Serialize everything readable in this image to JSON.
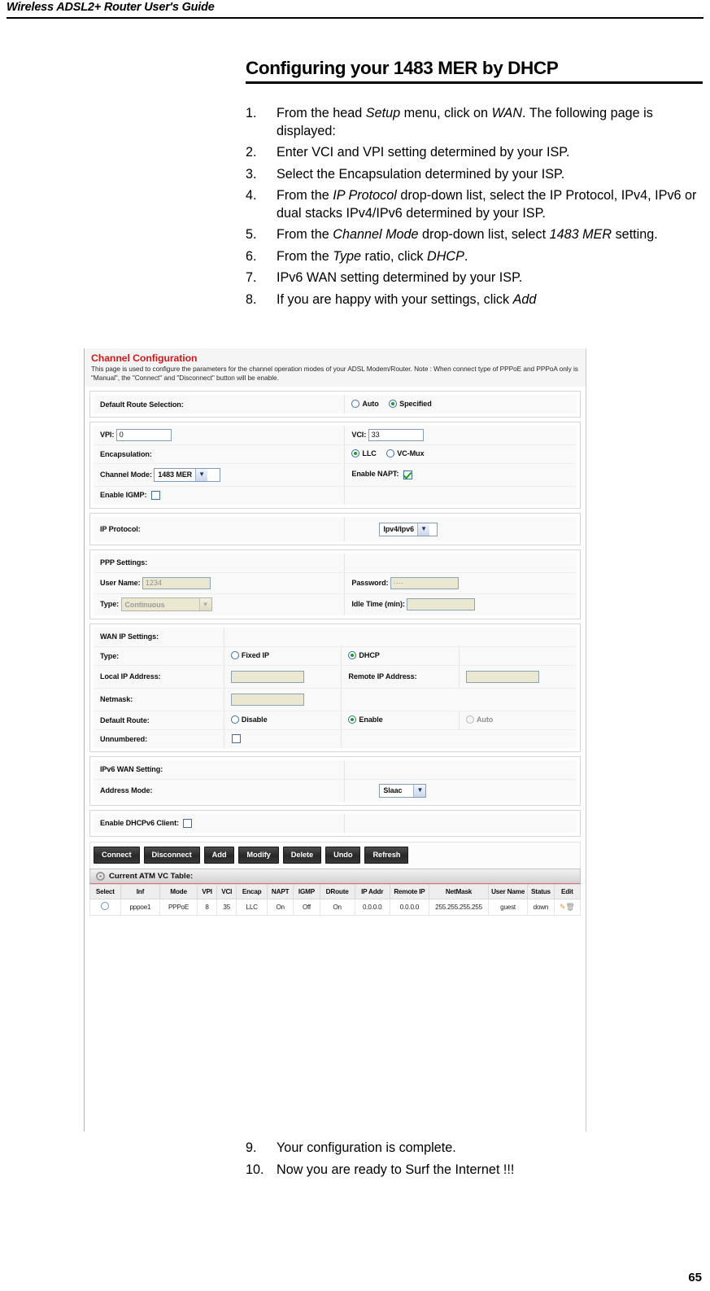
{
  "header": {
    "running_title": "Wireless ADSL2+ Router User's Guide"
  },
  "section": {
    "title": "Configuring your 1483 MER by DHCP"
  },
  "steps_top": [
    {
      "num": "1.",
      "html": "From the head <i>Setup</i> menu, click on <i>WAN</i>. The following page is displayed:"
    },
    {
      "num": "2.",
      "html": "Enter VCI and VPI setting determined by your ISP."
    },
    {
      "num": "3.",
      "html": "Select the Encapsulation determined by your ISP."
    },
    {
      "num": "4.",
      "html": "From the <i>IP Protocol</i> drop-down list, select the IP Protocol, IPv4, IPv6 or dual stacks IPv4/IPv6 determined by your ISP."
    },
    {
      "num": "5.",
      "html": "From the <i>Channel Mode</i> drop-down list, select <i>1483 MER</i> setting."
    },
    {
      "num": "6.",
      "html": "From the <i>Type</i> ratio, click <i>DHCP</i>."
    },
    {
      "num": "7.",
      "html": "IPv6 WAN setting determined by your ISP."
    },
    {
      "num": "8.",
      "html": "If you are happy with your settings, click <i>Add</i>"
    }
  ],
  "steps_bottom": [
    {
      "num": "9.",
      "html": "Your configuration is complete."
    },
    {
      "num": "10.",
      "html": "Now you are ready to Surf the Internet !!!"
    }
  ],
  "figure": {
    "panel": {
      "heading": "Channel Configuration",
      "description": "This page is used to configure the parameters for the channel operation modes of your ADSL Modem/Router. Note : When connect type of PPPoE and PPPoA only is \"Manual\", the \"Connect\" and \"Disconnect\" button will be enable."
    },
    "default_route_selection": {
      "label": "Default Route Selection:",
      "options": [
        "Auto",
        "Specified"
      ],
      "selected": "Specified"
    },
    "atm": {
      "vpi_label": "VPI:",
      "vpi_value": "0",
      "vci_label": "VCI:",
      "vci_value": "33",
      "encapsulation_label": "Encapsulation:",
      "encapsulation_options": [
        "LLC",
        "VC-Mux"
      ],
      "encapsulation_selected": "LLC",
      "channel_mode_label": "Channel Mode:",
      "channel_mode_value": "1483 MER",
      "enable_napt_label": "Enable NAPT:",
      "enable_napt_checked": true,
      "enable_igmp_label": "Enable IGMP:",
      "enable_igmp_checked": false
    },
    "ip_protocol": {
      "label": "IP Protocol:",
      "value": "Ipv4/Ipv6"
    },
    "ppp": {
      "section_label": "PPP Settings:",
      "user_name_label": "User Name:",
      "user_name_value": "1234",
      "password_label": "Password:",
      "password_value": "····",
      "type_label": "Type:",
      "type_value": "Continuous",
      "idle_time_label": "Idle Time (min):",
      "idle_time_value": ""
    },
    "wan_ip": {
      "section_label": "WAN IP Settings:",
      "type_label": "Type:",
      "type_options": [
        "Fixed IP",
        "DHCP"
      ],
      "type_selected": "DHCP",
      "local_ip_label": "Local IP Address:",
      "local_ip_value": "",
      "remote_ip_label": "Remote IP Address:",
      "remote_ip_value": "",
      "netmask_label": "Netmask:",
      "netmask_value": "",
      "default_route_label": "Default Route:",
      "default_route_options": [
        "Disable",
        "Enable",
        "Auto"
      ],
      "default_route_selected": "Enable",
      "unnumbered_label": "Unnumbered:",
      "unnumbered_checked": false
    },
    "ipv6_wan": {
      "section_label": "IPv6 WAN Setting:",
      "address_mode_label": "Address Mode:",
      "address_mode_value": "Slaac"
    },
    "dhcpv6": {
      "label": "Enable DHCPv6 Client:",
      "checked": false
    },
    "buttons": [
      "Connect",
      "Disconnect",
      "Add",
      "Modify",
      "Delete",
      "Undo",
      "Refresh"
    ],
    "vc_table": {
      "title": "Current ATM VC Table:",
      "columns": [
        "Select",
        "Inf",
        "Mode",
        "VPI",
        "VCI",
        "Encap",
        "NAPT",
        "IGMP",
        "DRoute",
        "IP Addr",
        "Remote IP",
        "NetMask",
        "User Name",
        "Status",
        "Edit"
      ],
      "rows": [
        {
          "inf": "pppoe1",
          "mode": "PPPoE",
          "vpi": "8",
          "vci": "35",
          "encap": "LLC",
          "napt": "On",
          "igmp": "Off",
          "droute": "On",
          "ip_addr": "0.0.0.0",
          "remote_ip": "0.0.0.0",
          "netmask": "255.255.255.255",
          "user_name": "guest",
          "status": "down"
        }
      ]
    }
  },
  "footer": {
    "page_number": "65"
  },
  "colors": {
    "heading_red": "#d01b1b",
    "radio_dot_green": "#17a01b",
    "button_dark": "#2a2a2a",
    "disabled_field": "#e9e6cf"
  }
}
